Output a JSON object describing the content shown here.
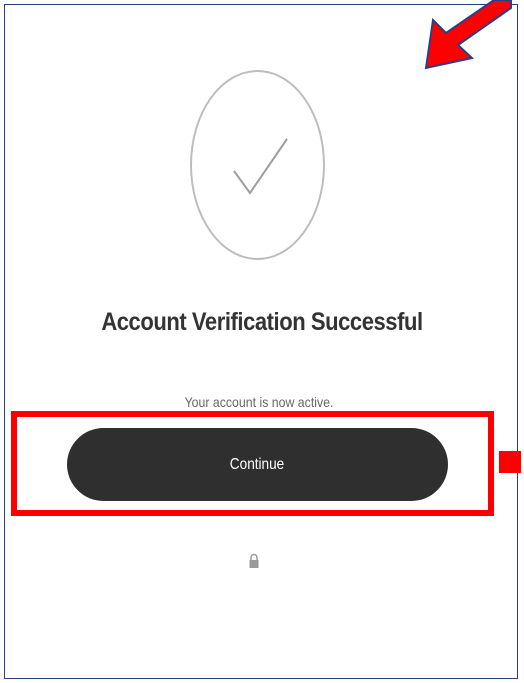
{
  "verification": {
    "title": "Account Verification Successful",
    "message": "Your account is now active.",
    "continue_label": "Continue"
  },
  "icons": {
    "success": "checkmark-circle-icon",
    "lock": "lock-icon",
    "annotation_arrow": "red-arrow-icon"
  },
  "colors": {
    "button_background": "#2f2f2f",
    "annotation_red": "#ff0000",
    "frame_border": "#2b3f86",
    "circle_border": "#bdbdbd"
  }
}
